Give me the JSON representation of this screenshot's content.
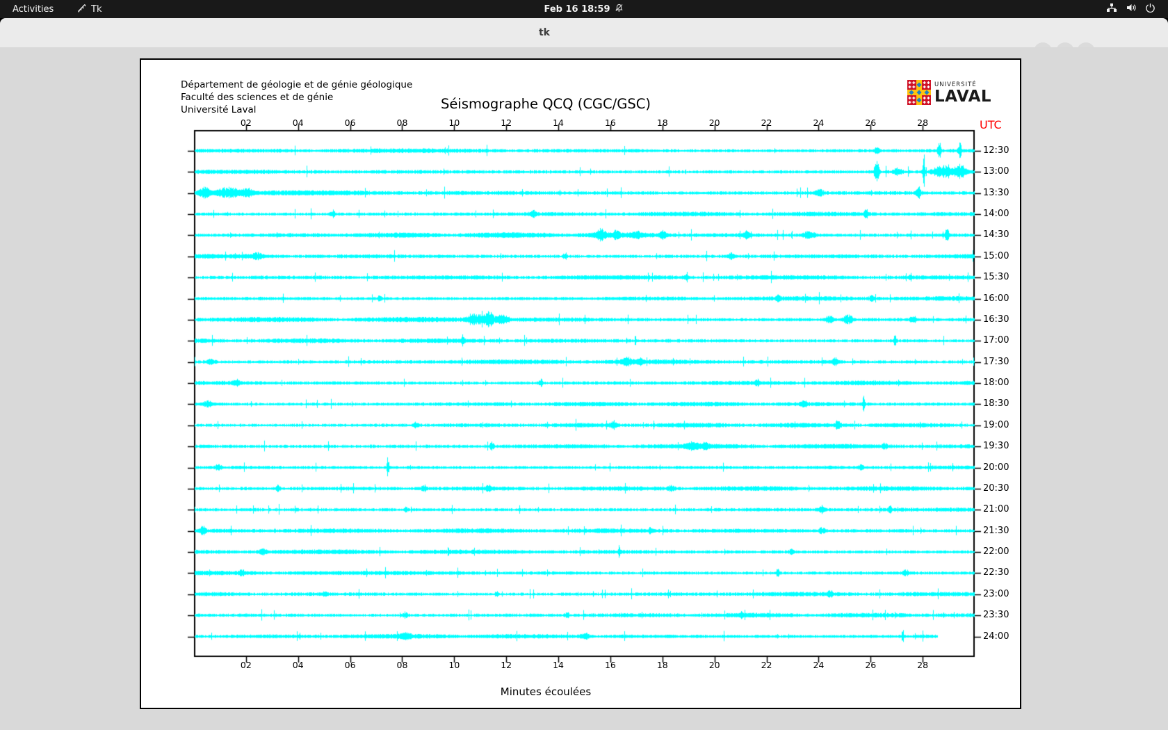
{
  "topbar": {
    "activities": "Activities",
    "app_name": "Tk",
    "clock": "Feb 16 18:59"
  },
  "window": {
    "title": "tk"
  },
  "seismograph": {
    "institution_lines": [
      "Département de géologie et de génie géologique",
      "Faculté des sciences et de génie",
      "Université Laval"
    ],
    "title": "Séismographe QCQ (CGC/GSC)",
    "utc_label": "UTC",
    "xlabel": "Minutes écoulées",
    "logo": {
      "top": "UNIVERSITÉ",
      "bottom": "LAVAL"
    },
    "colors": {
      "trace": "#00ffff",
      "utc": "#ff0000",
      "axis": "#000000",
      "window_bg": "#d9d9d9"
    }
  },
  "chart_data": {
    "type": "line",
    "title": "Séismographe QCQ (CGC/GSC)",
    "xlabel": "Minutes écoulées",
    "y_axis_label": "UTC",
    "x_range_minutes": [
      0,
      30
    ],
    "x_ticks": [
      "02",
      "04",
      "06",
      "08",
      "10",
      "12",
      "14",
      "16",
      "18",
      "20",
      "22",
      "24",
      "26",
      "28"
    ],
    "rows": [
      {
        "label": "12:30",
        "end": 1,
        "amp": 1,
        "events": [
          [
            26.2,
            0.1,
            5
          ],
          [
            28.6,
            0.08,
            14
          ],
          [
            29.4,
            0.08,
            12
          ]
        ]
      },
      {
        "label": "13:00",
        "end": 1,
        "amp": 1.1,
        "events": [
          [
            26.2,
            0.12,
            15
          ],
          [
            27.0,
            0.2,
            5
          ],
          [
            28.0,
            0.05,
            40
          ],
          [
            28.7,
            0.45,
            9
          ],
          [
            29.4,
            0.3,
            10
          ]
        ]
      },
      {
        "label": "13:30",
        "end": 1,
        "amp": 1.25,
        "events": [
          [
            0.4,
            0.3,
            7
          ],
          [
            1.3,
            0.5,
            8
          ],
          [
            2.0,
            0.3,
            6
          ],
          [
            24.0,
            0.2,
            5
          ],
          [
            27.8,
            0.12,
            9
          ]
        ]
      },
      {
        "label": "14:00",
        "end": 1,
        "amp": 1,
        "events": [
          [
            5.3,
            0.12,
            5
          ],
          [
            13.0,
            0.15,
            4
          ],
          [
            25.8,
            0.1,
            6
          ]
        ]
      },
      {
        "label": "14:30",
        "end": 1,
        "amp": 1.3,
        "events": [
          [
            15.6,
            0.25,
            8
          ],
          [
            16.2,
            0.15,
            6
          ],
          [
            17.0,
            0.3,
            4
          ],
          [
            18.0,
            0.2,
            5
          ],
          [
            21.2,
            0.15,
            6
          ],
          [
            23.6,
            0.3,
            5
          ],
          [
            28.9,
            0.12,
            8
          ]
        ]
      },
      {
        "label": "15:00",
        "end": 1,
        "amp": 1,
        "events": [
          [
            2.4,
            0.25,
            4
          ],
          [
            14.2,
            0.1,
            4
          ],
          [
            20.6,
            0.12,
            4
          ]
        ]
      },
      {
        "label": "15:30",
        "end": 1,
        "amp": 0.95,
        "events": [
          [
            18.9,
            0.08,
            6
          ],
          [
            27.5,
            0.08,
            4
          ]
        ]
      },
      {
        "label": "16:00",
        "end": 1,
        "amp": 1,
        "events": [
          [
            7.1,
            0.1,
            4
          ],
          [
            22.4,
            0.1,
            4
          ],
          [
            26.0,
            0.1,
            4
          ]
        ]
      },
      {
        "label": "16:30",
        "end": 1,
        "amp": 1.2,
        "events": [
          [
            10.8,
            0.4,
            8
          ],
          [
            11.3,
            0.25,
            11
          ],
          [
            11.8,
            0.3,
            6
          ],
          [
            24.4,
            0.2,
            5
          ],
          [
            25.1,
            0.25,
            6
          ],
          [
            27.6,
            0.15,
            5
          ]
        ]
      },
      {
        "label": "17:00",
        "end": 1,
        "amp": 1,
        "events": [
          [
            10.3,
            0.08,
            5
          ],
          [
            26.9,
            0.08,
            7
          ]
        ]
      },
      {
        "label": "17:30",
        "end": 1,
        "amp": 1.05,
        "events": [
          [
            0.6,
            0.2,
            4
          ],
          [
            16.6,
            0.25,
            5
          ],
          [
            17.1,
            0.15,
            4
          ],
          [
            24.6,
            0.15,
            5
          ]
        ]
      },
      {
        "label": "18:00",
        "end": 1,
        "amp": 1,
        "events": [
          [
            1.6,
            0.15,
            5
          ],
          [
            13.3,
            0.08,
            6
          ],
          [
            21.6,
            0.1,
            4
          ]
        ]
      },
      {
        "label": "18:30",
        "end": 1,
        "amp": 1,
        "events": [
          [
            0.5,
            0.2,
            5
          ],
          [
            23.4,
            0.12,
            5
          ],
          [
            25.7,
            0.05,
            12
          ]
        ]
      },
      {
        "label": "19:00",
        "end": 1,
        "amp": 1,
        "events": [
          [
            8.5,
            0.15,
            4
          ],
          [
            16.1,
            0.15,
            5
          ],
          [
            24.7,
            0.12,
            5
          ]
        ]
      },
      {
        "label": "19:30",
        "end": 1,
        "amp": 1.1,
        "events": [
          [
            11.4,
            0.12,
            5
          ],
          [
            19.1,
            0.25,
            6
          ],
          [
            19.6,
            0.15,
            5
          ],
          [
            26.5,
            0.1,
            4
          ]
        ]
      },
      {
        "label": "20:00",
        "end": 1,
        "amp": 1,
        "events": [
          [
            0.9,
            0.15,
            4
          ],
          [
            7.4,
            0.04,
            13
          ],
          [
            25.6,
            0.1,
            4
          ]
        ]
      },
      {
        "label": "20:30",
        "end": 1,
        "amp": 1,
        "events": [
          [
            3.2,
            0.1,
            4
          ],
          [
            8.8,
            0.12,
            5
          ],
          [
            11.3,
            0.15,
            4
          ],
          [
            18.3,
            0.15,
            4
          ]
        ]
      },
      {
        "label": "21:00",
        "end": 1,
        "amp": 1,
        "events": [
          [
            8.1,
            0.08,
            4
          ],
          [
            24.1,
            0.12,
            5
          ],
          [
            26.7,
            0.08,
            6
          ]
        ]
      },
      {
        "label": "21:30",
        "end": 1,
        "amp": 1,
        "events": [
          [
            0.3,
            0.12,
            6
          ],
          [
            17.5,
            0.1,
            4
          ],
          [
            24.1,
            0.15,
            5
          ]
        ]
      },
      {
        "label": "22:00",
        "end": 1,
        "amp": 1,
        "events": [
          [
            2.6,
            0.15,
            4
          ],
          [
            16.3,
            0.04,
            11
          ],
          [
            22.9,
            0.1,
            4
          ]
        ]
      },
      {
        "label": "22:30",
        "end": 1,
        "amp": 1,
        "events": [
          [
            1.8,
            0.1,
            4
          ],
          [
            22.4,
            0.08,
            6
          ],
          [
            27.3,
            0.15,
            5
          ]
        ]
      },
      {
        "label": "23:00",
        "end": 1,
        "amp": 0.95,
        "events": [
          [
            5.0,
            0.1,
            4
          ],
          [
            11.6,
            0.08,
            4
          ],
          [
            24.4,
            0.12,
            5
          ]
        ]
      },
      {
        "label": "23:30",
        "end": 1,
        "amp": 1,
        "events": [
          [
            8.1,
            0.12,
            4
          ],
          [
            14.3,
            0.08,
            4
          ],
          [
            21.0,
            0.1,
            4
          ]
        ]
      },
      {
        "label": "24:00",
        "end": 0.953,
        "amp": 1,
        "events": [
          [
            8.1,
            0.25,
            4
          ],
          [
            15.0,
            0.2,
            4
          ],
          [
            27.2,
            0.05,
            11
          ]
        ]
      }
    ]
  }
}
